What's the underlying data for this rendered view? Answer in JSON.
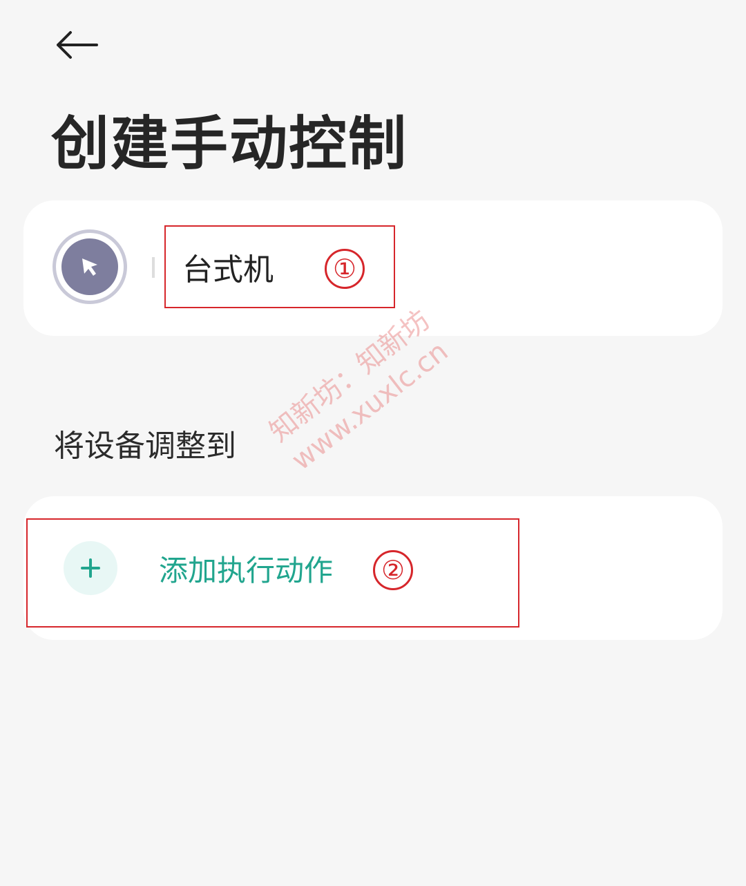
{
  "header": {
    "back_icon": "arrow-left-icon",
    "title": "创建手动控制"
  },
  "device": {
    "icon": "cursor-arrow-icon",
    "name": "台式机"
  },
  "section": {
    "label": "将设备调整到"
  },
  "action": {
    "icon": "plus-icon",
    "add_label": "添加执行动作"
  },
  "annotations": {
    "marker_1": "①",
    "marker_2": "②"
  },
  "watermark": {
    "line1": "知新坊：知新坊",
    "line2": "www.xuxlc.cn"
  },
  "colors": {
    "background": "#f6f6f6",
    "card": "#ffffff",
    "accent": "#21a58e",
    "annotation": "#d6262b",
    "device_icon": "#7e7e9e"
  }
}
